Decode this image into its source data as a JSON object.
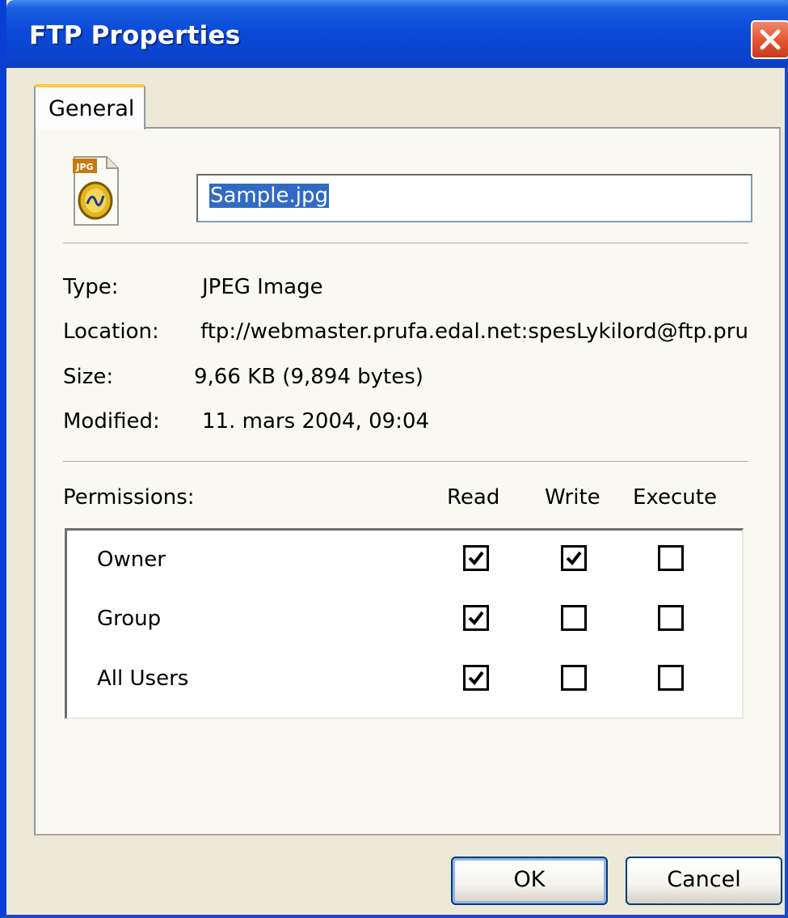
{
  "window": {
    "title": "FTP Properties"
  },
  "tabs": [
    {
      "label": "General"
    }
  ],
  "file": {
    "icon": "jpg-file-icon",
    "icon_badge": "JPG",
    "name": "Sample.jpg"
  },
  "properties": {
    "type_label": "Type:",
    "type_value": "JPEG Image",
    "location_label": "Location:",
    "location_value": "ftp://webmaster.prufa.edal.net:spesLykilord@ftp.pru",
    "size_label": "Size:",
    "size_value": "9,66 KB (9,894 bytes)",
    "modified_label": "Modified:",
    "modified_value": "11. mars 2004, 09:04"
  },
  "permissions": {
    "label": "Permissions:",
    "columns": [
      "Read",
      "Write",
      "Execute"
    ],
    "rows": [
      {
        "name": "Owner",
        "read": true,
        "write": true,
        "execute": false
      },
      {
        "name": "Group",
        "read": true,
        "write": false,
        "execute": false
      },
      {
        "name": "All Users",
        "read": true,
        "write": false,
        "execute": false
      }
    ]
  },
  "buttons": {
    "ok": "OK",
    "cancel": "Cancel"
  },
  "colors": {
    "titlebar": "#0a44cf",
    "dialog_bg": "#ece9d8",
    "selection": "#316ac5",
    "tab_highlight": "#ffc83c"
  }
}
